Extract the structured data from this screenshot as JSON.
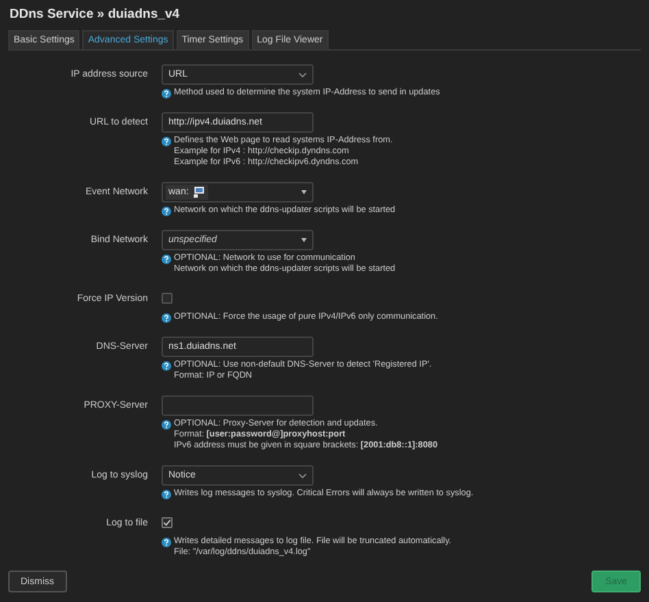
{
  "title": "DDns Service » duiadns_v4",
  "tabs": [
    {
      "label": "Basic Settings",
      "selected": false
    },
    {
      "label": "Advanced Settings",
      "selected": true
    },
    {
      "label": "Timer Settings",
      "selected": false
    },
    {
      "label": "Log File Viewer",
      "selected": false
    }
  ],
  "fields": [
    {
      "label": "IP address source",
      "kind": "select",
      "value": "URL",
      "help": [
        "Method used to determine the system IP-Address to send in updates"
      ]
    },
    {
      "label": "URL to detect",
      "kind": "text",
      "value": "http://ipv4.duiadns.net",
      "help": [
        "Defines the Web page to read systems IP-Address from.",
        "Example for IPv4 : http://checkip.dyndns.com",
        "Example for IPv6 : http://checkipv6.dyndns.com"
      ]
    },
    {
      "label": "Event Network",
      "kind": "network-chip",
      "value": "wan:",
      "help": [
        "Network on which the ddns-updater scripts will be started"
      ]
    },
    {
      "label": "Bind Network",
      "kind": "network",
      "value": "unspecified",
      "help": [
        "OPTIONAL: Network to use for communication",
        "Network on which the ddns-updater scripts will be started"
      ]
    },
    {
      "label": "Force IP Version",
      "kind": "checkbox",
      "checked": false,
      "help": [
        "OPTIONAL: Force the usage of pure IPv4/IPv6 only communication."
      ]
    },
    {
      "label": "DNS-Server",
      "kind": "text",
      "value": "ns1.duiadns.net",
      "help": [
        "OPTIONAL: Use non-default DNS-Server to detect 'Registered IP'.",
        "Format: IP or FQDN"
      ]
    },
    {
      "label": "PROXY-Server",
      "kind": "text",
      "help": [
        "OPTIONAL: Proxy-Server for detection and updates.",
        "Format: **[user:password@]proxyhost:port**",
        "IPv6 address must be given in square brackets: **[2001:db8::1]:8080**"
      ]
    },
    {
      "label": "Log to syslog",
      "kind": "select",
      "value": "Notice",
      "help": [
        "Writes log messages to syslog. Critical Errors will always be written to syslog."
      ]
    },
    {
      "label": "Log to file",
      "kind": "checkbox",
      "checked": true,
      "help": [
        "Writes detailed messages to log file. File will be truncated automatically.",
        "File: \"/var/log/ddns/duiadns_v4.log\""
      ]
    }
  ],
  "buttons": {
    "dismiss": "Dismiss",
    "save": "Save"
  }
}
